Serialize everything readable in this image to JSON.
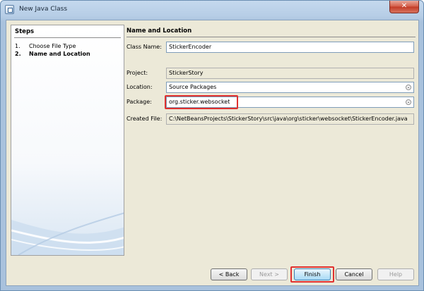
{
  "window": {
    "title": "New Java Class",
    "close_label": "✕"
  },
  "steps": {
    "title": "Steps",
    "items": [
      {
        "num": "1.",
        "label": "Choose File Type"
      },
      {
        "num": "2.",
        "label": "Name and Location"
      }
    ]
  },
  "form": {
    "title": "Name and Location",
    "class_name": {
      "label": "Class Name:",
      "value": "StickerEncoder"
    },
    "project": {
      "label": "Project:",
      "value": "StickerStory"
    },
    "location": {
      "label": "Location:",
      "value": "Source Packages"
    },
    "package": {
      "label": "Package:",
      "value": "org.sticker.websocket"
    },
    "created_file": {
      "label": "Created File:",
      "value": "C:\\NetBeansProjects\\StickerStory\\src\\java\\org\\sticker\\websocket\\StickerEncoder.java"
    }
  },
  "buttons": {
    "back": "< Back",
    "next": "Next >",
    "finish": "Finish",
    "cancel": "Cancel",
    "help": "Help"
  },
  "colors": {
    "highlight": "#e0312f",
    "title_bar": "#b6cde6",
    "dialog_bg": "#ece9d8"
  }
}
